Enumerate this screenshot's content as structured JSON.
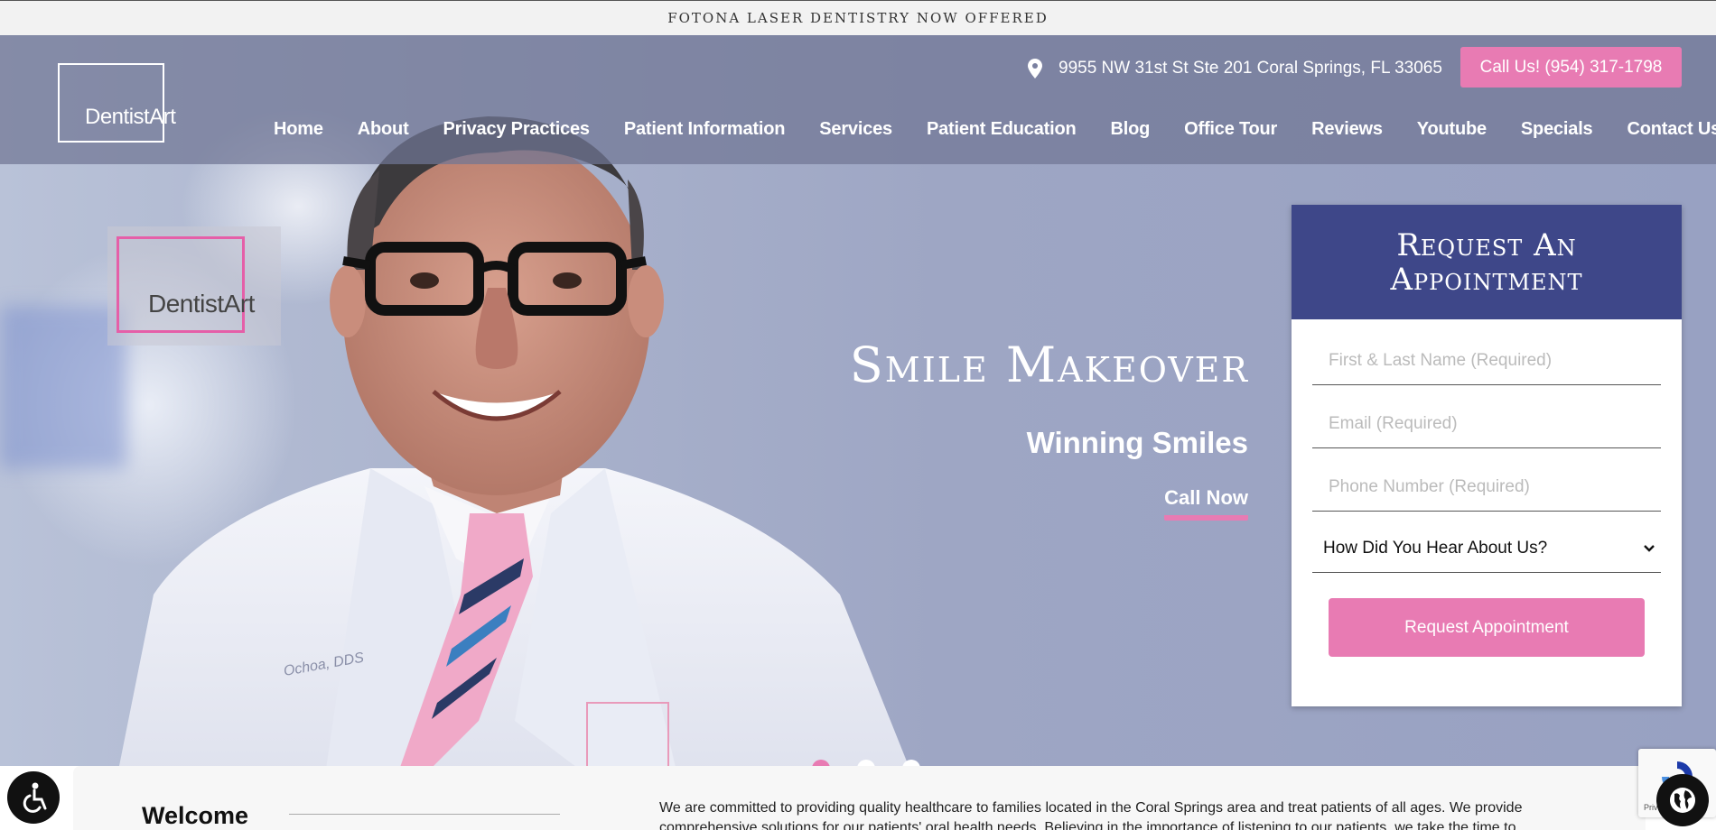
{
  "announcement": {
    "text": "FOTONA LASER DENTISTRY NOW OFFERED"
  },
  "header": {
    "logo_text": "DentistArt",
    "address": "9955 NW 31st St Ste 201 Coral Springs, FL 33065",
    "call_button": "Call Us! (954) 317-1798",
    "nav": [
      "Home",
      "About",
      "Privacy Practices",
      "Patient Information",
      "Services",
      "Patient Education",
      "Blog",
      "Office Tour",
      "Reviews",
      "Youtube",
      "Specials",
      "Contact Us"
    ]
  },
  "hero": {
    "logo_text": "DentistArt",
    "title": "Smile Makeover",
    "subtitle": "Winning Smiles",
    "cta": "Call Now",
    "coat_name": "Ochoa, DDS",
    "slides_total": 3,
    "active_slide": 1
  },
  "form": {
    "title": "Request An\nAppointment",
    "name_placeholder": "First & Last Name (Required)",
    "email_placeholder": "Email (Required)",
    "phone_placeholder": "Phone Number (Required)",
    "source_select": "How Did You Hear About Us?",
    "submit_label": "Request Appointment"
  },
  "welcome": {
    "heading": "Welcome",
    "paragraph": "We are committed to providing quality healthcare to families located in the Coral Springs area and treat patients of all ages. We provide comprehensive solutions for our patients' oral health needs. Believing in the importance of listening to our patients, we take the time to truly"
  },
  "recaptcha": {
    "label": "Privacy - Terms"
  },
  "colors": {
    "accent_pink": "#e87bb3",
    "form_header": "#3e4789"
  }
}
